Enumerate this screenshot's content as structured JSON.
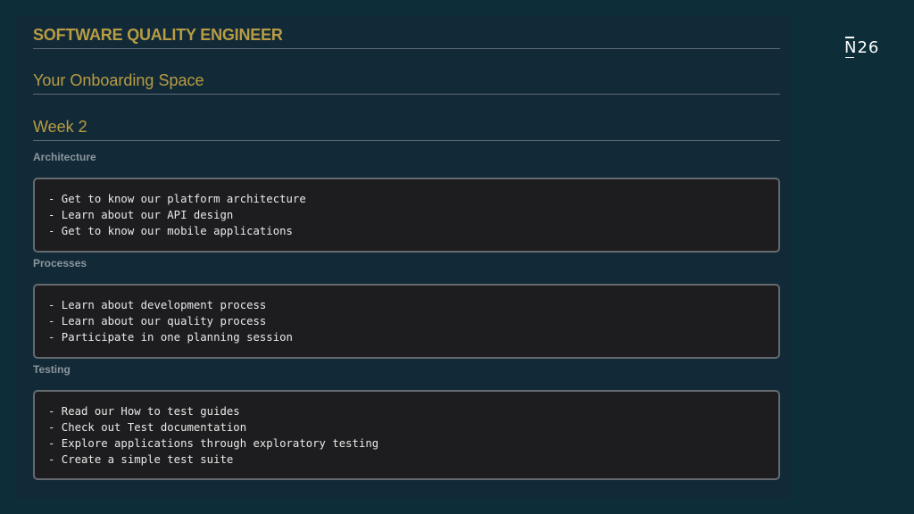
{
  "logo": {
    "text": "N26"
  },
  "title": "SOFTWARE QUALITY ENGINEER",
  "subtitle": "Your Onboarding Space",
  "week": "Week 2",
  "sections": [
    {
      "heading": "Architecture",
      "items": [
        "- Get to know our platform architecture",
        "- Learn about our API design",
        "- Get to know our mobile applications"
      ]
    },
    {
      "heading": "Processes",
      "items": [
        "- Learn about development process",
        "- Learn about our quality process",
        "- Participate in one planning session"
      ]
    },
    {
      "heading": "Testing",
      "items": [
        "- Read our How to test guides",
        "- Check out Test documentation",
        "- Explore applications through exploratory testing",
        "- Create a simple test suite"
      ]
    }
  ]
}
